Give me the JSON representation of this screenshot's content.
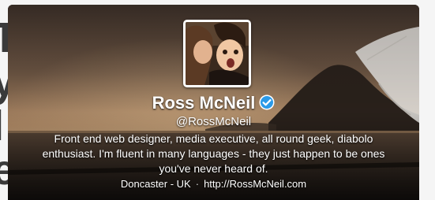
{
  "profile": {
    "name": "Ross McNeil",
    "screen_name": "@RossMcNeil",
    "bio_lines": [
      "Front end web designer, media executive, all round geek, diabolo",
      "enthusiast. I'm fluent in many languages - they just happen to be ones",
      "you've never heard of."
    ],
    "location": "Doncaster - UK",
    "separator": "·",
    "url": "http://RossMcNeil.com",
    "verified": true
  },
  "icons": {
    "verified": "verified-check-icon"
  },
  "colors": {
    "text": "#ffffff",
    "verified_blue": "#2b9ae8",
    "sky_top": "#4a3b31",
    "sky_horizon": "#b08a64",
    "sea": "#3a2f28"
  }
}
